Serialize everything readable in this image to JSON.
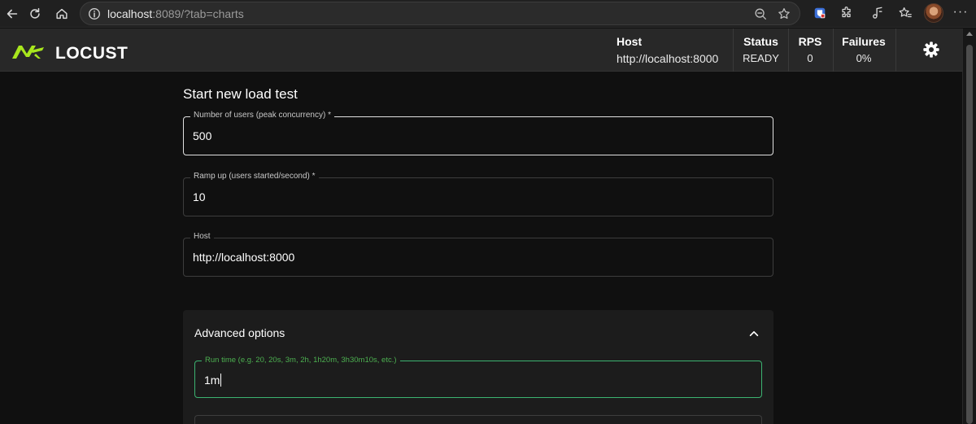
{
  "browser": {
    "url_host": "localhost",
    "url_rest": ":8089/?tab=charts"
  },
  "app": {
    "logo_text": "LOCUST",
    "colors": {
      "accent": "#a8e61d",
      "focus": "#4caf50",
      "header_bg": "#282828",
      "page_bg": "#101010"
    }
  },
  "header": {
    "host_label": "Host",
    "host_value": "http://localhost:8000",
    "status_label": "Status",
    "status_value": "READY",
    "rps_label": "RPS",
    "rps_value": "0",
    "failures_label": "Failures",
    "failures_value": "0%"
  },
  "form": {
    "title": "Start new load test",
    "users_label": "Number of users (peak concurrency) *",
    "users_value": "500",
    "ramp_label": "Ramp up (users started/second) *",
    "ramp_value": "10",
    "host_label": "Host",
    "host_value": "http://localhost:8000"
  },
  "advanced": {
    "title": "Advanced options",
    "runtime_label": "Run time (e.g. 20, 20s, 3m, 2h, 1h20m, 3h30m10s, etc.)",
    "runtime_value": "1m"
  }
}
